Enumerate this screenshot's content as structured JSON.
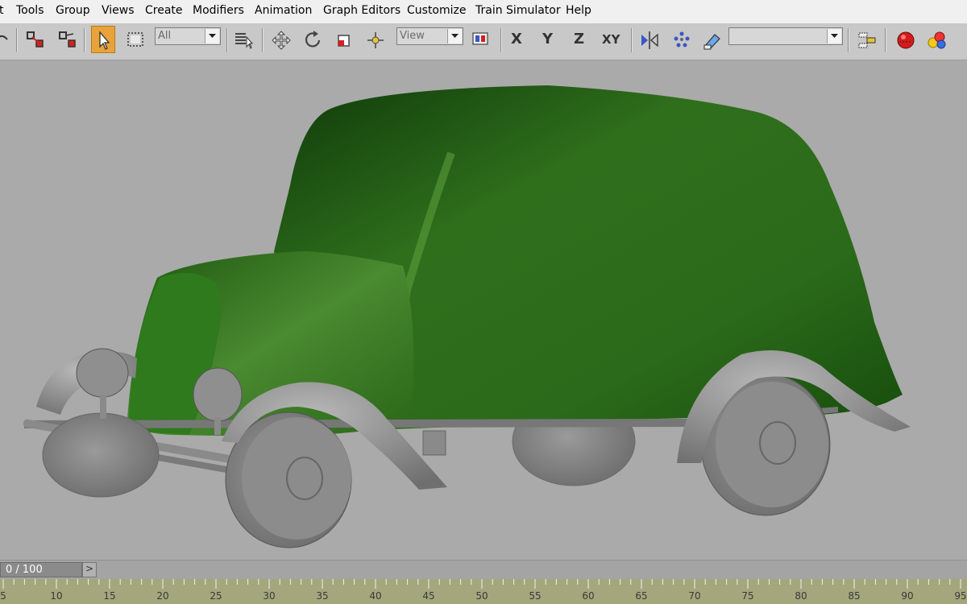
{
  "menu": {
    "items": [
      "t",
      "Tools",
      "Group",
      "Views",
      "Create",
      "Modifiers",
      "Animation",
      "Graph Editors",
      "Customize",
      "Train Simulator",
      "Help"
    ]
  },
  "toolbar": {
    "selection_filter": "All",
    "reference_coord": "View",
    "constrain_x": "X",
    "constrain_y": "Y",
    "constrain_z": "Z",
    "constrain_xy": "XY",
    "named_selection_set": "",
    "colors": {
      "active_tool": "#e8a33a"
    }
  },
  "viewport": {
    "object": "green vintage car",
    "colors": {
      "body": "#3b8a22",
      "wheels": "#8e8e8e",
      "background": "#aaaaaa"
    }
  },
  "timeslider": {
    "frame_label": "0 / 100",
    "next_label": ">"
  },
  "trackbar": {
    "ticks": [
      "5",
      "10",
      "15",
      "20",
      "25",
      "30",
      "35",
      "40",
      "45",
      "50",
      "55",
      "60",
      "65",
      "70",
      "75",
      "80",
      "85",
      "90",
      "95"
    ]
  }
}
